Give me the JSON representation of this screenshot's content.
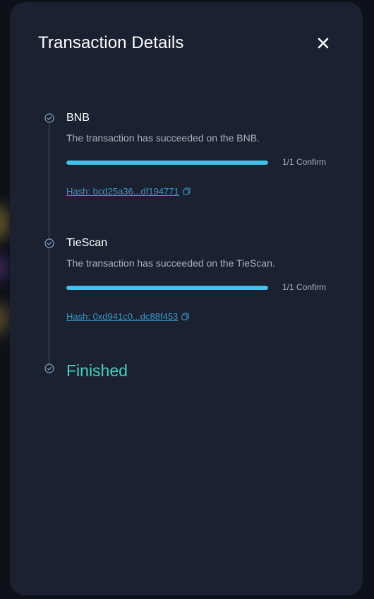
{
  "modal": {
    "title": "Transaction Details",
    "close_icon": "close-icon"
  },
  "steps": [
    {
      "name": "BNB",
      "description": "The transaction has succeeded on the BNB.",
      "progress": 1.0,
      "confirm_text": "1/1 Confirm",
      "hash_text": "Hash: bcd25a36...df194771",
      "status_icon": "check-circle-icon"
    },
    {
      "name": "TieScan",
      "description": "The transaction has succeeded on the TieScan.",
      "progress": 1.0,
      "confirm_text": "1/1 Confirm",
      "hash_text": "Hash: 0xd941c0...dc88f453",
      "status_icon": "check-circle-icon"
    }
  ],
  "final": {
    "label": "Finished",
    "status_icon": "check-circle-icon"
  },
  "colors": {
    "modal_bg": "#1b2130",
    "accent_progress": "#3fc3ea",
    "hash_link": "#3b98c4",
    "finished": "#3ed3c0"
  }
}
